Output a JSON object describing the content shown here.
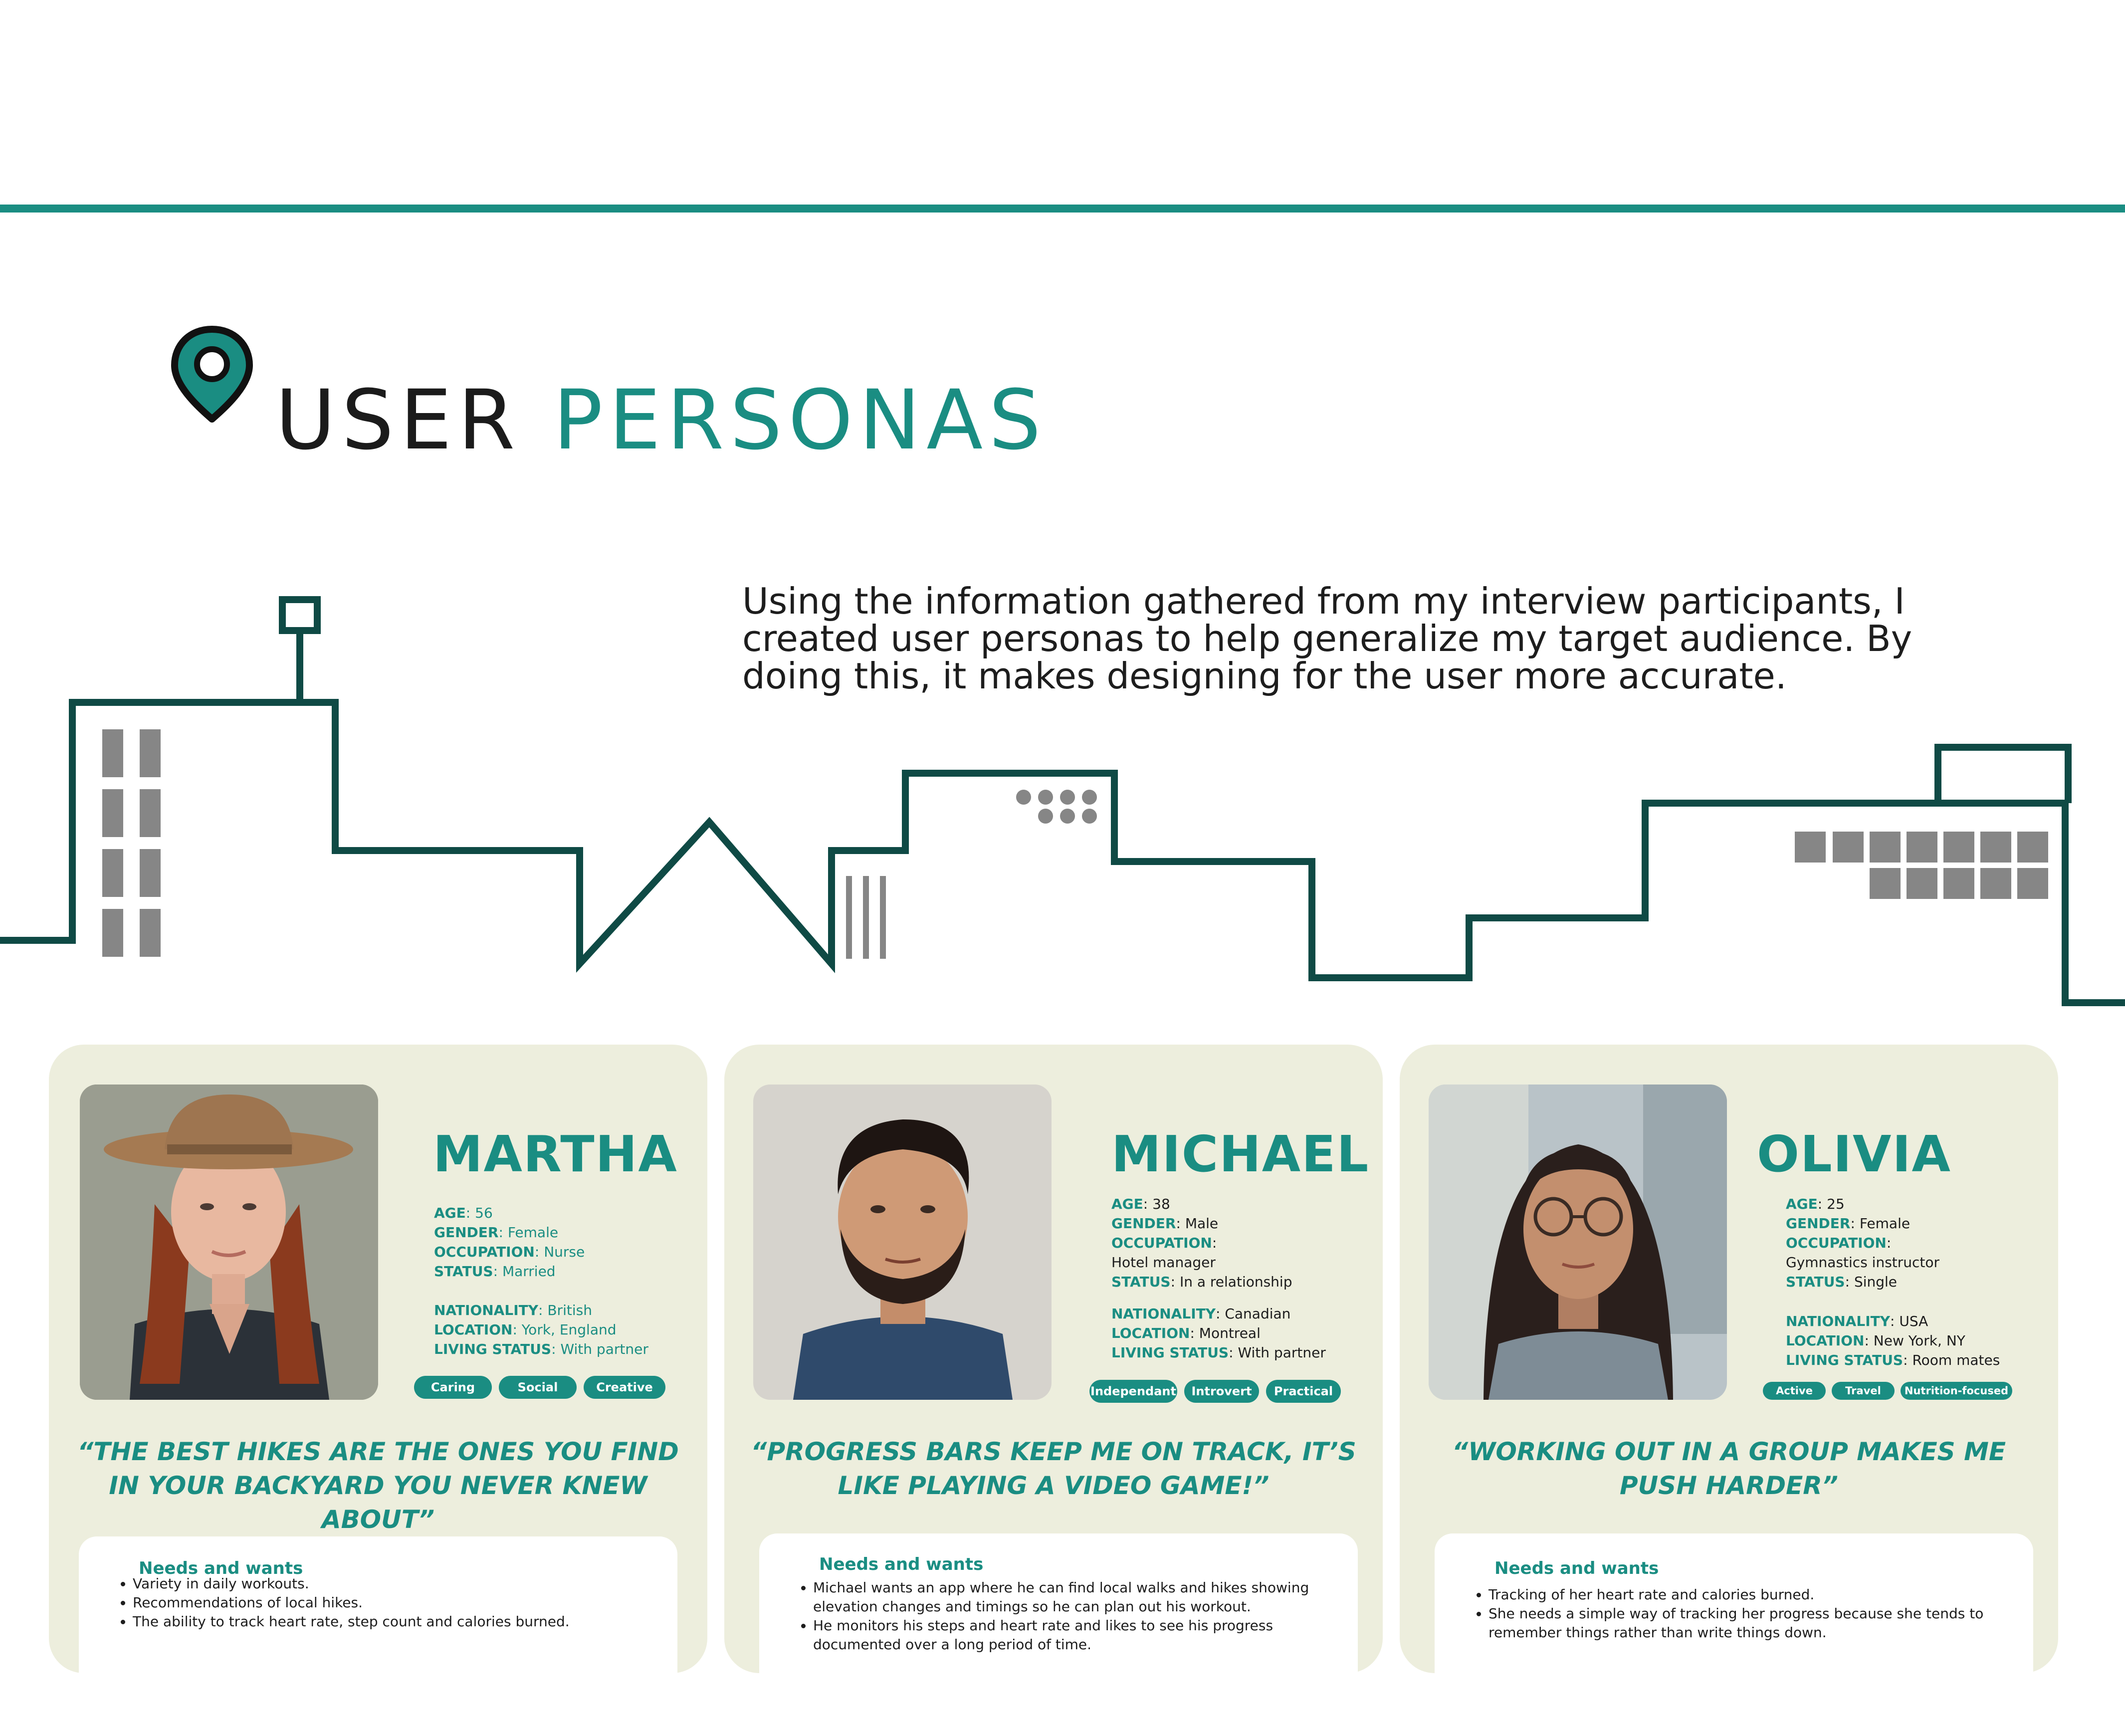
{
  "header": {
    "title_part1": "USER",
    "title_part2": "PERSONAS",
    "intro": "Using the information gathered from my interview participants, I created user personas to help generalize my target audience. By doing this, it makes designing for the user more accurate."
  },
  "personas": [
    {
      "name": "MARTHA",
      "age_label": "AGE",
      "age": "56",
      "gender_label": "GENDER",
      "gender": "Female",
      "occupation_label": "OCCUPATION",
      "occupation": "Nurse",
      "status_label": "STATUS",
      "status": "Married",
      "nationality_label": "NATIONALITY",
      "nationality": "British",
      "location_label": "LOCATION",
      "location": "York, England",
      "living_label": "LIVING STATUS",
      "living": "With partner",
      "tags": [
        "Caring",
        "Social",
        "Creative"
      ],
      "quote": "“THE BEST HIKES ARE THE ONES YOU FIND IN YOUR BACKYARD YOU NEVER KNEW ABOUT”",
      "needs_title": "Needs and wants",
      "needs": [
        "Variety in daily workouts.",
        "Recommendations of local hikes.",
        "The ability to track heart rate, step count and calories burned."
      ]
    },
    {
      "name": "MICHAEL",
      "age_label": "AGE",
      "age": "38",
      "gender_label": "GENDER",
      "gender": "Male",
      "occupation_label": "OCCUPATION",
      "occupation": "Hotel manager",
      "status_label": "STATUS",
      "status": "In a relationship",
      "nationality_label": "NATIONALITY",
      "nationality": "Canadian",
      "location_label": "LOCATION",
      "location": "Montreal",
      "living_label": "LIVING STATUS",
      "living": "With partner",
      "tags": [
        "Independant",
        "Introvert",
        "Practical"
      ],
      "quote": "“PROGRESS BARS KEEP ME ON TRACK, IT’S LIKE PLAYING A VIDEO GAME!”",
      "needs_title": "Needs and wants",
      "needs": [
        "Michael wants an app where he can find local walks and hikes showing elevation changes and timings so he can plan out his workout.",
        "He monitors his steps and heart rate and likes to see his progress documented over a long period of time."
      ]
    },
    {
      "name": "OLIVIA",
      "age_label": "AGE",
      "age": "25",
      "gender_label": "GENDER",
      "gender": "Female",
      "occupation_label": "OCCUPATION",
      "occupation": "Gymnastics instructor",
      "status_label": "STATUS",
      "status": "Single",
      "nationality_label": "NATIONALITY",
      "nationality": "USA",
      "location_label": "LOCATION",
      "location": "New York, NY",
      "living_label": "LIVING STATUS",
      "living": "Room mates",
      "tags": [
        "Active",
        "Travel",
        "Nutrition-focused"
      ],
      "quote": "“WORKING OUT IN A GROUP MAKES ME PUSH HARDER”",
      "needs_title": "Needs and wants",
      "needs": [
        "Tracking of her heart rate and calories burned.",
        "She needs a simple way of tracking her progress because she tends to remember things rather than write things down."
      ]
    }
  ],
  "colors": {
    "accent": "#1a8d82",
    "skyline": "#0f4a45",
    "card_bg": "#edeedd",
    "window_gray": "#868686"
  },
  "icons": {
    "title_icon": "location-pin-icon"
  }
}
